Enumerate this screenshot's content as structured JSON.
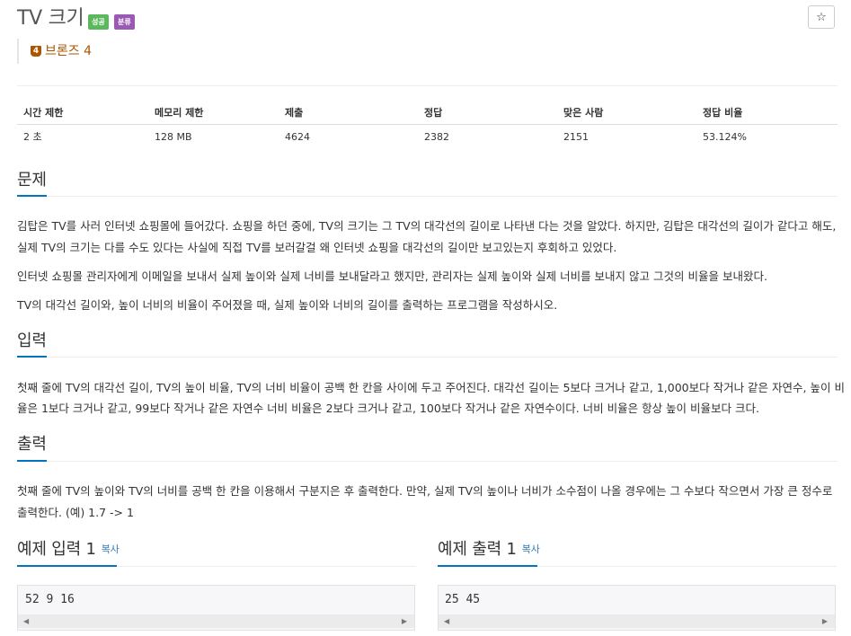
{
  "problem": {
    "title": "TV 크기",
    "badges": {
      "success": "성공",
      "class": "분류"
    },
    "star_icon": "☆",
    "tier": {
      "icon_text": "4",
      "label": "브론즈 4",
      "color": "#ad5600"
    }
  },
  "stats": {
    "headers": [
      "시간 제한",
      "메모리 제한",
      "제출",
      "정답",
      "맞은 사람",
      "정답 비율"
    ],
    "values": [
      "2 초",
      "128 MB",
      "4624",
      "2382",
      "2151",
      "53.124%"
    ]
  },
  "sections": {
    "description": {
      "heading": "문제",
      "paragraphs": [
        "김탑은 TV를 사러 인터넷 쇼핑몰에 들어갔다. 쇼핑을 하던 중에, TV의 크기는 그 TV의 대각선의 길이로 나타낸 다는 것을 알았다. 하지만, 김탑은 대각선의 길이가 같다고 해도,",
        "실제 TV의 크기는 다를 수도 있다는 사실에 직접 TV를 보러갈걸 왜 인터넷 쇼핑을 대각선의 길이만 보고있는지 후회하고 있었다.",
        "인터넷 쇼핑몰 관리자에게 이메일을 보내서 실제 높이와 실제 너비를 보내달라고 했지만, 관리자는 실제 높이와 실제 너비를 보내지 않고 그것의 비율을 보내왔다.",
        "TV의 대각선 길이와, 높이 너비의 비율이 주어졌을 때, 실제 높이와 너비의 길이를 출력하는 프로그램을 작성하시오."
      ]
    },
    "input": {
      "heading": "입력",
      "lines": [
        "첫째 줄에 TV의 대각선 길이, TV의 높이 비율, TV의 너비 비율이 공백 한 칸을 사이에 두고 주어진다. 대각선 길이는 5보다 크거나 같고, 1,000보다 작거나 같은 자연수, 높이 비",
        "율은 1보다 크거나 같고, 99보다 작거나 같은 자연수 너비 비율은 2보다 크거나 같고, 100보다 작거나 같은 자연수이다. 너비 비율은 항상 높이 비율보다 크다."
      ]
    },
    "output": {
      "heading": "출력",
      "lines": [
        "첫째 줄에 TV의 높이와 TV의 너비를 공백 한 칸을 이용해서 구분지은 후 출력한다. 만약, 실제 TV의 높이나 너비가 소수점이 나올 경우에는 그 수보다 작으면서 가장 큰 정수로",
        "출력한다. (예) 1.7 -> 1"
      ]
    }
  },
  "samples": {
    "input": {
      "heading": "예제 입력 1",
      "copy_label": "복사",
      "content": "52 9 16"
    },
    "output": {
      "heading": "예제 출력 1",
      "copy_label": "복사",
      "content": "25 45"
    },
    "scroll_left_icon": "◀",
    "scroll_right_icon": "▶"
  },
  "colors": {
    "accent": "#0076c0",
    "success": "#5cb85c",
    "class": "#9b59b6",
    "link": "#337ab7"
  }
}
